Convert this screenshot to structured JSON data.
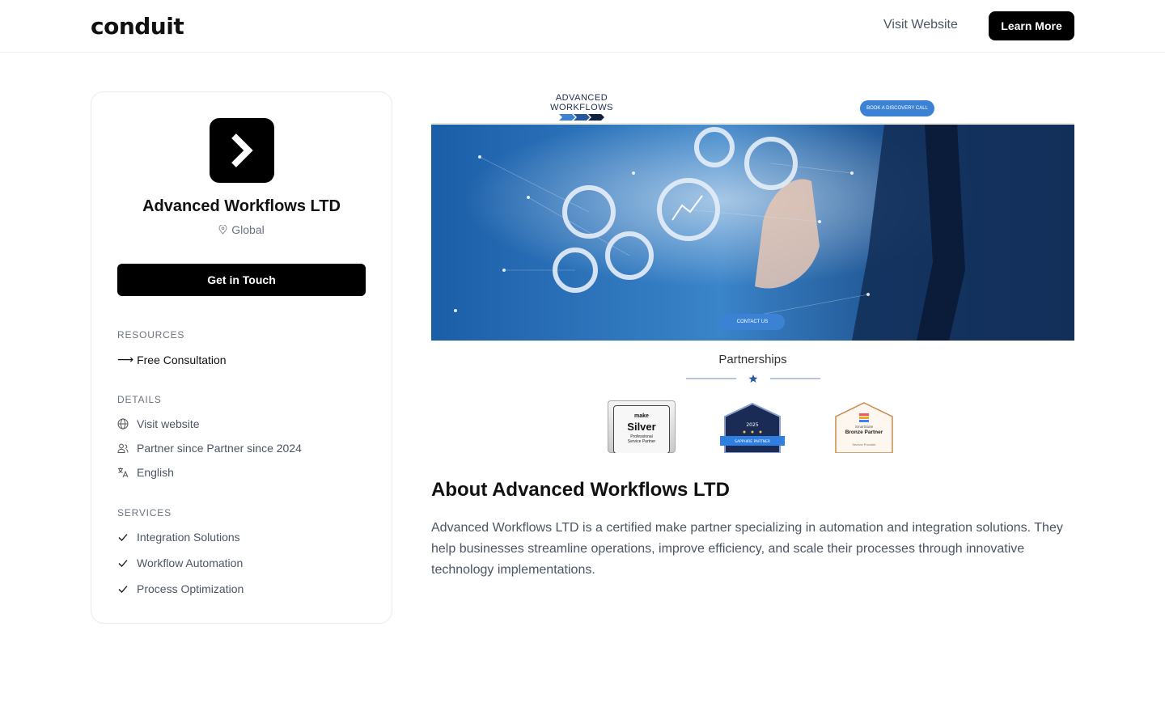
{
  "header": {
    "logo": "conduit",
    "visit_website": "Visit Website",
    "learn_more": "Learn More"
  },
  "profile": {
    "name": "Advanced Workflows LTD",
    "location": "Global",
    "cta": "Get in Touch"
  },
  "resources": {
    "title": "RESOURCES",
    "items": [
      {
        "label": "Free Consultation",
        "icon": "arrow-right-icon"
      }
    ]
  },
  "details": {
    "title": "DETAILS",
    "items": [
      {
        "label": "Visit website",
        "icon": "globe-icon"
      },
      {
        "label": "Partner since Partner since 2024",
        "icon": "users-icon"
      },
      {
        "label": "English",
        "icon": "language-icon"
      }
    ]
  },
  "services": {
    "title": "SERVICES",
    "items": [
      {
        "label": "Integration Solutions",
        "icon": "check-icon"
      },
      {
        "label": "Workflow Automation",
        "icon": "check-icon"
      },
      {
        "label": "Process Optimization",
        "icon": "check-icon"
      }
    ]
  },
  "hero": {
    "brand_line1": "ADVANCED",
    "brand_line2": "WORKFLOWS",
    "cta": "BOOK A DISCOVERY CALL",
    "contact": "CONTACT US",
    "partnerships": "Partnerships",
    "badges": [
      {
        "brand": "make",
        "title": "Silver",
        "subtitle1": "Professional",
        "subtitle2": "Service Partner"
      },
      {
        "year": "2025",
        "label": "SAPPHIRE PARTNER"
      },
      {
        "brand": "SmartSuite",
        "title": "Bronze Partner",
        "subtitle": "Service Provider"
      }
    ]
  },
  "about": {
    "title": "About Advanced Workflows LTD",
    "text": "Advanced Workflows LTD is a certified make partner specializing in automation and integration solutions. They help businesses streamline operations, improve efficiency, and scale their processes through innovative technology implementations."
  },
  "colors": {
    "primary": "#000000",
    "muted": "#6b7280",
    "accent_blue": "#3b82d4"
  }
}
